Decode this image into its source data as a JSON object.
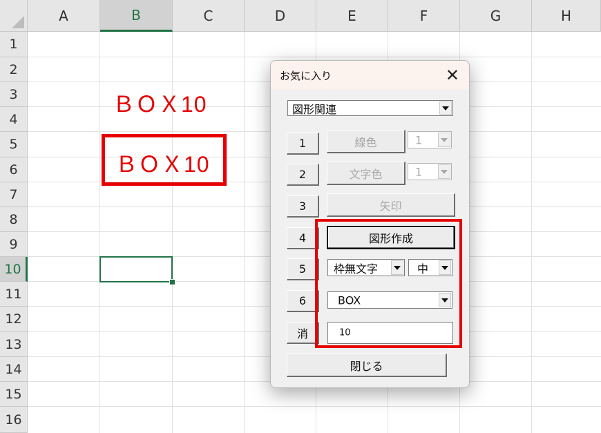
{
  "sheet": {
    "columns": [
      "A",
      "B",
      "C",
      "D",
      "E",
      "F",
      "G",
      "H"
    ],
    "rows": [
      "1",
      "2",
      "3",
      "4",
      "5",
      "6",
      "7",
      "8",
      "9",
      "10",
      "11",
      "12",
      "13",
      "14",
      "15",
      "16"
    ],
    "active_column": "B",
    "active_row": "10",
    "shape_text_plain": "ＢＯＸ10",
    "shape_text_boxed": "ＢＯＸ10",
    "shape_color": "#e60000"
  },
  "dialog": {
    "title": "お気に入り",
    "close_icon": "close-icon",
    "category_select": {
      "value": "図形関連"
    },
    "row_buttons": [
      "1",
      "2",
      "3",
      "4",
      "5",
      "6",
      "消"
    ],
    "line_color_button": "線色",
    "line_color_select": "1",
    "text_color_button": "文字色",
    "text_color_select": "1",
    "arrow_button": "矢印",
    "create_shape_button": "図形作成",
    "frame_style_select": "枠無文字",
    "size_select": "中",
    "shape_type_select": "BOX",
    "text_input_value": "10",
    "close_button": "閉じる"
  },
  "colors": {
    "accent_green": "#217346",
    "highlight_red": "#e60000"
  }
}
